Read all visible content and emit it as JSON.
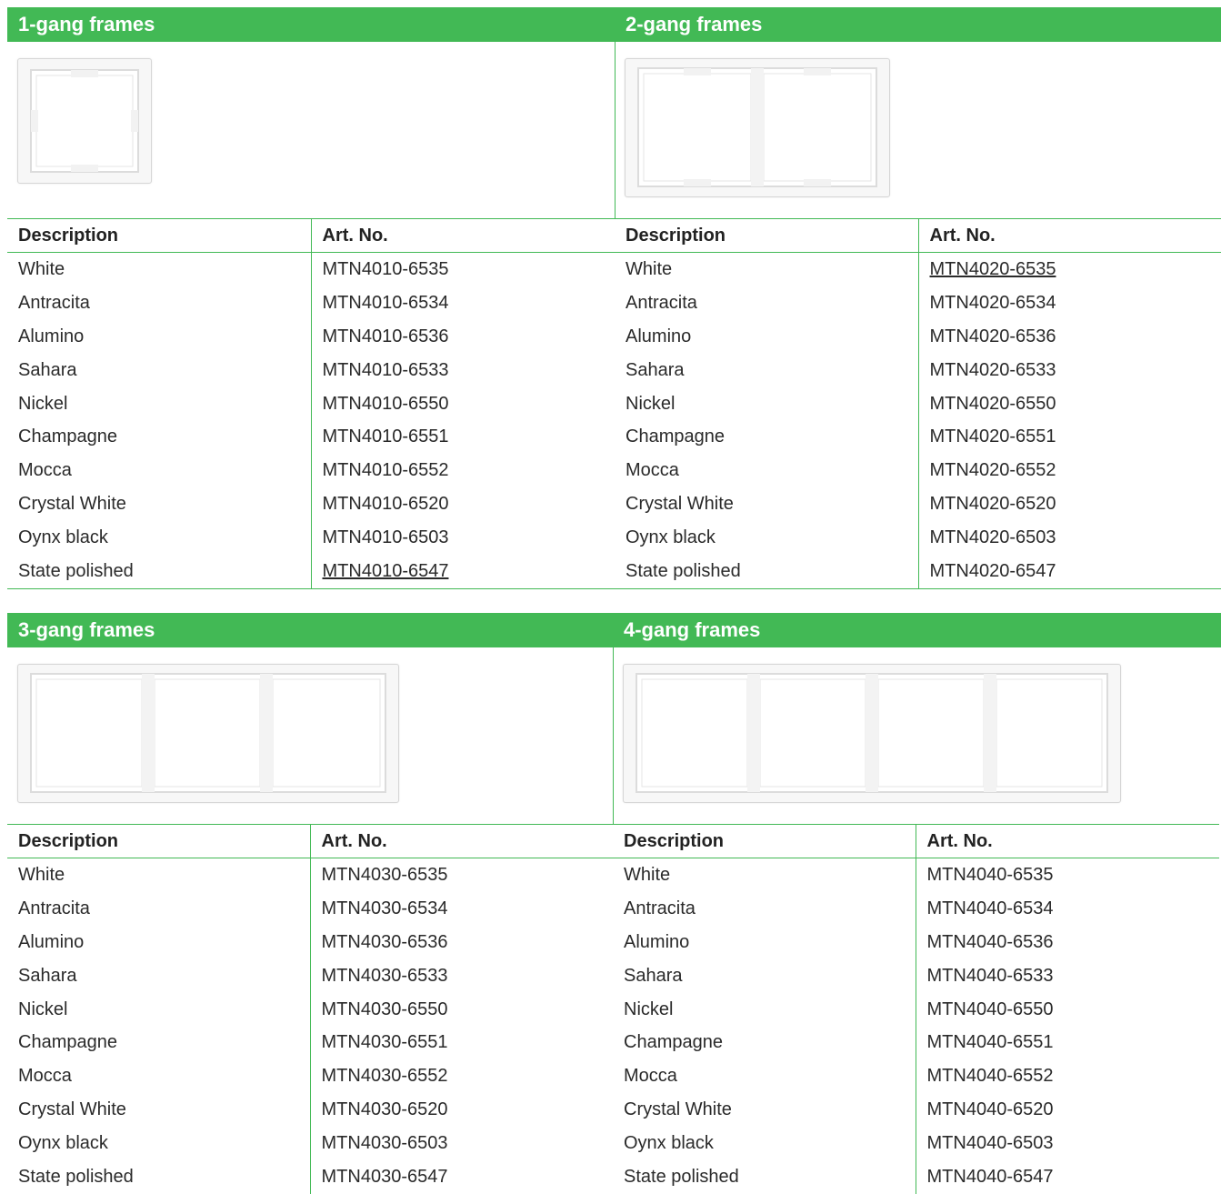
{
  "columns": {
    "description": "Description",
    "art_no": "Art. No."
  },
  "sections": [
    {
      "title": "1-gang frames",
      "image_icon": "1-gang-frame-image",
      "rows": [
        {
          "description": "White",
          "art_no": "MTN4010-6535"
        },
        {
          "description": "Antracita",
          "art_no": "MTN4010-6534"
        },
        {
          "description": "Alumino",
          "art_no": "MTN4010-6536"
        },
        {
          "description": "Sahara",
          "art_no": "MTN4010-6533"
        },
        {
          "description": "Nickel",
          "art_no": "MTN4010-6550"
        },
        {
          "description": "Champagne",
          "art_no": "MTN4010-6551"
        },
        {
          "description": "Mocca",
          "art_no": "MTN4010-6552"
        },
        {
          "description": "Crystal White",
          "art_no": "MTN4010-6520"
        },
        {
          "description": "Oynx black",
          "art_no": "MTN4010-6503"
        },
        {
          "description": "State polished",
          "art_no": "MTN4010-6547"
        }
      ]
    },
    {
      "title": "2-gang frames",
      "image_icon": "2-gang-frame-image",
      "rows": [
        {
          "description": "White",
          "art_no": "MTN4020-6535"
        },
        {
          "description": "Antracita",
          "art_no": "MTN4020-6534"
        },
        {
          "description": "Alumino",
          "art_no": "MTN4020-6536"
        },
        {
          "description": "Sahara",
          "art_no": "MTN4020-6533"
        },
        {
          "description": "Nickel",
          "art_no": "MTN4020-6550"
        },
        {
          "description": "Champagne",
          "art_no": "MTN4020-6551"
        },
        {
          "description": "Mocca",
          "art_no": "MTN4020-6552"
        },
        {
          "description": "Crystal White",
          "art_no": "MTN4020-6520"
        },
        {
          "description": "Oynx black",
          "art_no": "MTN4020-6503"
        },
        {
          "description": "State polished",
          "art_no": "MTN4020-6547"
        }
      ]
    },
    {
      "title": "3-gang frames",
      "image_icon": "3-gang-frame-image",
      "rows": [
        {
          "description": "White",
          "art_no": "MTN4030-6535"
        },
        {
          "description": "Antracita",
          "art_no": "MTN4030-6534"
        },
        {
          "description": "Alumino",
          "art_no": "MTN4030-6536"
        },
        {
          "description": "Sahara",
          "art_no": "MTN4030-6533"
        },
        {
          "description": "Nickel",
          "art_no": "MTN4030-6550"
        },
        {
          "description": "Champagne",
          "art_no": "MTN4030-6551"
        },
        {
          "description": "Mocca",
          "art_no": "MTN4030-6552"
        },
        {
          "description": "Crystal White",
          "art_no": "MTN4030-6520"
        },
        {
          "description": "Oynx black",
          "art_no": "MTN4030-6503"
        },
        {
          "description": "State polished",
          "art_no": "MTN4030-6547"
        }
      ]
    },
    {
      "title": "4-gang frames",
      "image_icon": "4-gang-frame-image",
      "rows": [
        {
          "description": "White",
          "art_no": "MTN4040-6535"
        },
        {
          "description": "Antracita",
          "art_no": "MTN4040-6534"
        },
        {
          "description": "Alumino",
          "art_no": "MTN4040-6536"
        },
        {
          "description": "Sahara",
          "art_no": "MTN4040-6533"
        },
        {
          "description": "Nickel",
          "art_no": "MTN4040-6550"
        },
        {
          "description": "Champagne",
          "art_no": "MTN4040-6551"
        },
        {
          "description": "Mocca",
          "art_no": "MTN4040-6552"
        },
        {
          "description": "Crystal White",
          "art_no": "MTN4040-6520"
        },
        {
          "description": "Oynx black",
          "art_no": "MTN4040-6503"
        },
        {
          "description": "State polished",
          "art_no": "MTN4040-6547"
        }
      ]
    }
  ],
  "colors": {
    "header_green": "#42b955",
    "text": "#222222"
  }
}
